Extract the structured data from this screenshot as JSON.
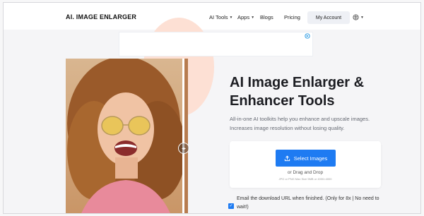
{
  "header": {
    "logo": "AI. IMAGE ENLARGER",
    "nav": [
      {
        "label": "AI Tools",
        "has_caret": true
      },
      {
        "label": "Apps",
        "has_caret": true
      },
      {
        "label": "Blogs",
        "has_caret": false
      },
      {
        "label": "Pricing",
        "has_caret": false
      }
    ],
    "account_label": "My Account",
    "language_icon": "language-icon"
  },
  "ad": {
    "badge_icon": "adchoices-icon"
  },
  "hero": {
    "title": "AI Image Enlarger & Enhancer Tools",
    "description": "All-in-one AI toolkits help you enhance and upscale images. Increases image resolution without losing quality."
  },
  "upload": {
    "button_label": "Select Images",
    "drag_text": "or Drag and Drop",
    "hint_text": "JPG or PNG Max Size 5MB or 4000×4000"
  },
  "email_option": {
    "text": "Email the download URL when finished. (Only for 8x | No need to wait!)",
    "checked": true
  },
  "colors": {
    "accent": "#1e7bf2",
    "blob": "#fde0d4"
  }
}
